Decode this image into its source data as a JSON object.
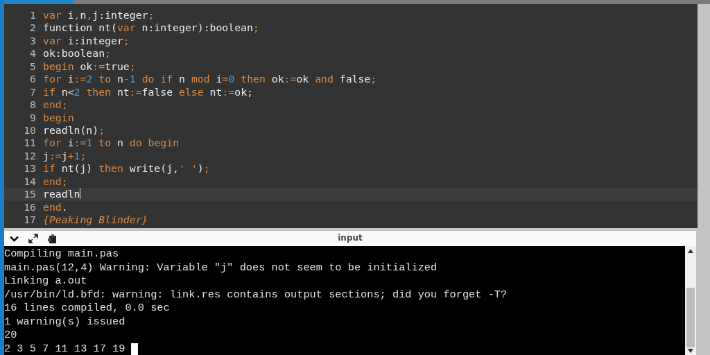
{
  "editor": {
    "lines": [
      {
        "number": "1",
        "current": false,
        "tokens": [
          {
            "kind": "keyword",
            "text": "var"
          },
          {
            "kind": "plain",
            "text": " i"
          },
          {
            "kind": "operator",
            "text": ","
          },
          {
            "kind": "plain",
            "text": "n"
          },
          {
            "kind": "operator",
            "text": ","
          },
          {
            "kind": "plain",
            "text": "j:integer"
          },
          {
            "kind": "operator",
            "text": ";"
          }
        ]
      },
      {
        "number": "2",
        "current": false,
        "tokens": [
          {
            "kind": "plain",
            "text": "function nt("
          },
          {
            "kind": "keyword",
            "text": "var"
          },
          {
            "kind": "plain",
            "text": " n:integer):boolean"
          },
          {
            "kind": "operator",
            "text": ";"
          }
        ]
      },
      {
        "number": "3",
        "current": false,
        "tokens": [
          {
            "kind": "keyword",
            "text": "var"
          },
          {
            "kind": "plain",
            "text": " i:integer"
          },
          {
            "kind": "operator",
            "text": ";"
          }
        ]
      },
      {
        "number": "4",
        "current": false,
        "tokens": [
          {
            "kind": "plain",
            "text": "ok:boolean"
          },
          {
            "kind": "operator",
            "text": ";"
          }
        ]
      },
      {
        "number": "5",
        "current": false,
        "tokens": [
          {
            "kind": "keyword",
            "text": "begin"
          },
          {
            "kind": "plain",
            "text": " ok"
          },
          {
            "kind": "operator",
            "text": ":="
          },
          {
            "kind": "plain",
            "text": "true"
          },
          {
            "kind": "operator",
            "text": ";"
          }
        ]
      },
      {
        "number": "6",
        "current": false,
        "tokens": [
          {
            "kind": "keyword",
            "text": "for"
          },
          {
            "kind": "plain",
            "text": " i"
          },
          {
            "kind": "operator",
            "text": ":="
          },
          {
            "kind": "number",
            "text": "2"
          },
          {
            "kind": "keyword",
            "text": " to"
          },
          {
            "kind": "plain",
            "text": " n"
          },
          {
            "kind": "operator",
            "text": "-"
          },
          {
            "kind": "number",
            "text": "1"
          },
          {
            "kind": "keyword",
            "text": " do if"
          },
          {
            "kind": "plain",
            "text": " n "
          },
          {
            "kind": "keyword",
            "text": "mod"
          },
          {
            "kind": "plain",
            "text": " i"
          },
          {
            "kind": "operator",
            "text": "="
          },
          {
            "kind": "number",
            "text": "0"
          },
          {
            "kind": "keyword",
            "text": " then"
          },
          {
            "kind": "plain",
            "text": " ok"
          },
          {
            "kind": "operator",
            "text": ":="
          },
          {
            "kind": "plain",
            "text": "ok "
          },
          {
            "kind": "keyword",
            "text": "and"
          },
          {
            "kind": "plain",
            "text": " false"
          },
          {
            "kind": "operator",
            "text": ";"
          }
        ]
      },
      {
        "number": "7",
        "current": false,
        "tokens": [
          {
            "kind": "keyword",
            "text": "if"
          },
          {
            "kind": "plain",
            "text": " n<"
          },
          {
            "kind": "number",
            "text": "2"
          },
          {
            "kind": "keyword",
            "text": " then"
          },
          {
            "kind": "plain",
            "text": " nt"
          },
          {
            "kind": "operator",
            "text": ":="
          },
          {
            "kind": "plain",
            "text": "false "
          },
          {
            "kind": "keyword",
            "text": "else"
          },
          {
            "kind": "plain",
            "text": " nt"
          },
          {
            "kind": "operator",
            "text": ":="
          },
          {
            "kind": "plain",
            "text": "ok;"
          }
        ]
      },
      {
        "number": "8",
        "current": false,
        "tokens": [
          {
            "kind": "keyword",
            "text": "end"
          },
          {
            "kind": "operator",
            "text": ";"
          }
        ]
      },
      {
        "number": "9",
        "current": false,
        "tokens": [
          {
            "kind": "keyword",
            "text": "begin"
          }
        ]
      },
      {
        "number": "10",
        "current": false,
        "tokens": [
          {
            "kind": "plain",
            "text": "readln(n)"
          },
          {
            "kind": "operator",
            "text": ";"
          }
        ]
      },
      {
        "number": "11",
        "current": false,
        "tokens": [
          {
            "kind": "keyword",
            "text": "for"
          },
          {
            "kind": "plain",
            "text": " i"
          },
          {
            "kind": "operator",
            "text": ":="
          },
          {
            "kind": "number",
            "text": "1"
          },
          {
            "kind": "keyword",
            "text": " to"
          },
          {
            "kind": "plain",
            "text": " n "
          },
          {
            "kind": "keyword",
            "text": "do begin"
          }
        ]
      },
      {
        "number": "12",
        "current": false,
        "tokens": [
          {
            "kind": "plain",
            "text": "j"
          },
          {
            "kind": "operator",
            "text": ":="
          },
          {
            "kind": "plain",
            "text": "j"
          },
          {
            "kind": "operator",
            "text": "+"
          },
          {
            "kind": "number",
            "text": "1"
          },
          {
            "kind": "operator",
            "text": ";"
          }
        ]
      },
      {
        "number": "13",
        "current": false,
        "tokens": [
          {
            "kind": "keyword",
            "text": "if"
          },
          {
            "kind": "plain",
            "text": " nt(j) "
          },
          {
            "kind": "keyword",
            "text": "then"
          },
          {
            "kind": "plain",
            "text": " write(j,"
          },
          {
            "kind": "operator",
            "text": "' '"
          },
          {
            "kind": "plain",
            "text": ")"
          },
          {
            "kind": "operator",
            "text": ";"
          }
        ]
      },
      {
        "number": "14",
        "current": false,
        "tokens": [
          {
            "kind": "keyword",
            "text": "end"
          },
          {
            "kind": "operator",
            "text": ";"
          }
        ]
      },
      {
        "number": "15",
        "current": true,
        "tokens": [
          {
            "kind": "plain",
            "text": "readln"
          }
        ]
      },
      {
        "number": "16",
        "current": false,
        "tokens": [
          {
            "kind": "keyword",
            "text": "end"
          },
          {
            "kind": "plain",
            "text": "."
          }
        ]
      },
      {
        "number": "17",
        "current": false,
        "tokens": [
          {
            "kind": "comment",
            "text": "{Peaking Blinder}"
          }
        ]
      }
    ]
  },
  "console": {
    "title": "input",
    "lines": [
      "Compiling main.pas",
      "main.pas(12,4) Warning: Variable \"j\" does not seem to be initialized",
      "Linking a.out",
      "/usr/bin/ld.bfd: warning: link.res contains output sections; did you forget -T?",
      "16 lines compiled, 0.0 sec",
      "1 warning(s) issued",
      "20",
      "2 3 5 7 11 13 17 19"
    ]
  }
}
